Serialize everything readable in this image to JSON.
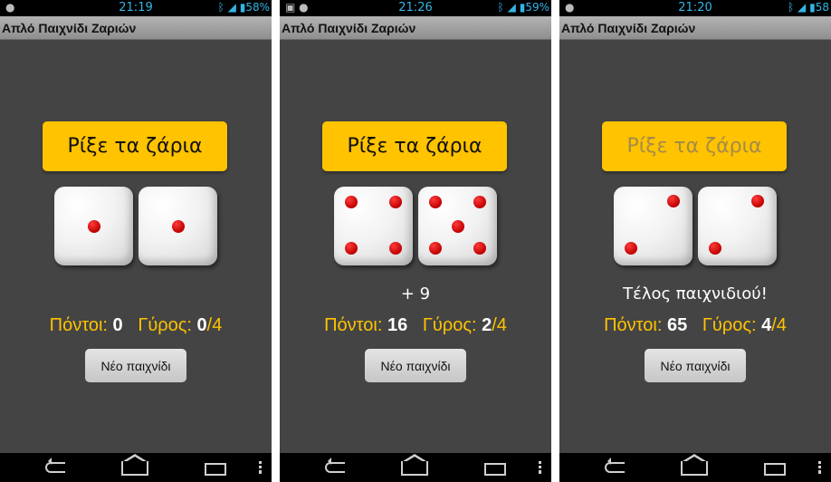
{
  "screens": [
    {
      "status": {
        "time": "21:19",
        "battery": "58%"
      },
      "app_title": "Απλό Παιχνίδι Ζαριών",
      "roll_button": "Ρίξε τα ζάρια",
      "roll_enabled": true,
      "dice": [
        1,
        1
      ],
      "result_text": "",
      "points_label": "Πόντοι:",
      "points": "0",
      "round_label": "Γύρος:",
      "round_current": "0",
      "round_total": "/4",
      "new_game_button": "Νέο παιχνίδι"
    },
    {
      "status": {
        "time": "21:26",
        "battery": "59%"
      },
      "app_title": "Απλό Παιχνίδι Ζαριών",
      "roll_button": "Ρίξε τα ζάρια",
      "roll_enabled": true,
      "dice": [
        4,
        5
      ],
      "result_text": "+ 9",
      "points_label": "Πόντοι:",
      "points": "16",
      "round_label": "Γύρος:",
      "round_current": "2",
      "round_total": "/4",
      "new_game_button": "Νέο παιχνίδι"
    },
    {
      "status": {
        "time": "21:20",
        "battery": "58"
      },
      "app_title": "Απλό Παιχνίδι Ζαριών",
      "roll_button": "Ρίξε τα ζάρια",
      "roll_enabled": false,
      "dice": [
        2,
        2
      ],
      "result_text": "Τέλος παιχνιδιού!",
      "points_label": "Πόντοι:",
      "points": "65",
      "round_label": "Γύρος:",
      "round_current": "4",
      "round_total": "/4",
      "new_game_button": "Νέο παιχνίδι"
    }
  ],
  "colors": {
    "accent": "#ffc300",
    "background": "#444444",
    "pip": "#d40000",
    "status_text": "#33b5e5"
  }
}
